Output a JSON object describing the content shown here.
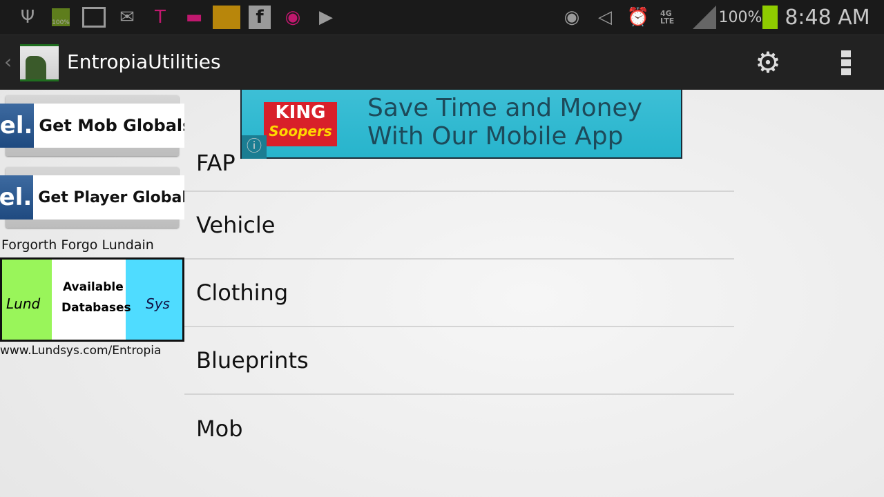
{
  "status_bar": {
    "left_icons": [
      "usb-icon",
      "battery-full-icon",
      "image-icon",
      "mail-icon",
      "tmobile-key-icon",
      "voicemail-icon",
      "dragon-app-icon",
      "facebook-icon",
      "tmobile-sync-icon",
      "play-store-icon"
    ],
    "battery_icon_label": "100%",
    "right_icons": [
      "smart-stay-eye-icon",
      "mute-icon",
      "alarm-icon",
      "4g-lte-icon",
      "signal-icon"
    ],
    "network": "4G LTE",
    "battery_percent": "100%",
    "battery_level": 1.0,
    "time": "8:48 AM",
    "battery_color": "#8fcc00"
  },
  "action_bar": {
    "title": "EntropiaUtilities",
    "settings_icon": "gear-icon",
    "overflow_icon": "overflow-menu-icon"
  },
  "sidebar": {
    "buttons": [
      {
        "badge": "el.",
        "label": "Get Mob Globals"
      },
      {
        "badge": "el.",
        "label": "Get Player Globals"
      }
    ],
    "credit": "Forgorth Forgo Lundain",
    "banner": {
      "left": "Lund",
      "middle_line1": "Available",
      "middle_line2": "Databases",
      "right": "Sys",
      "colors": {
        "left": "#99f55a",
        "right": "#4fdcff"
      }
    },
    "url": "www.Lundsys.com/Entropia"
  },
  "ad": {
    "brand_line1": "KING",
    "brand_line2": "Soopers",
    "text_line1": "Save Time and Money",
    "text_line2": "With Our Mobile App",
    "info_icon": "info-icon"
  },
  "list": {
    "items": [
      "FAP",
      "Vehicle",
      "Clothing",
      "Blueprints",
      "Mob"
    ]
  }
}
